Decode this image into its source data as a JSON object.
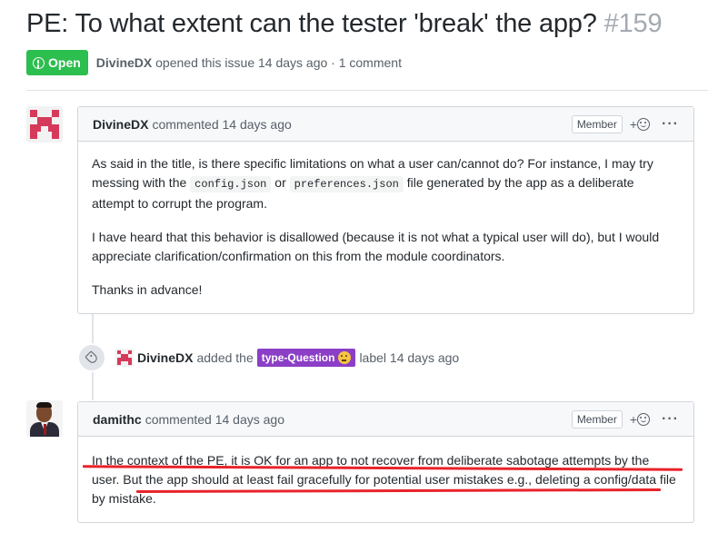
{
  "issue": {
    "title": "PE: To what extent can the tester 'break' the app?",
    "number": "#159",
    "state": "Open",
    "author": "DivineDX",
    "meta_rest": "opened this issue 14 days ago · 1 comment"
  },
  "comments": [
    {
      "author": "DivineDX",
      "action": "commented 14 days ago",
      "role": "Member",
      "react_plus": "+",
      "more": "···",
      "body": {
        "p1_a": "As said in the title, is there specific limitations on what a user can/cannot do? For instance, I may try messing with the ",
        "p1_code1": "config.json",
        "p1_b": " or ",
        "p1_code2": "preferences.json",
        "p1_c": " file generated by the app as a deliberate attempt to corrupt the program.",
        "p2": "I have heard that this behavior is disallowed (because it is not what a typical user will do), but I would appreciate clarification/confirmation on this from the module coordinators.",
        "p3": "Thanks in advance!"
      }
    },
    {
      "author": "damithc",
      "action": "commented 14 days ago",
      "role": "Member",
      "react_plus": "+",
      "more": "···",
      "body": {
        "line1": "In the context of the PE, it is OK for an app to not recover from deliberate sabotage attempts by the user.",
        "line2": "But the app should at least fail gracefully for potential user mistakes e.g., deleting a config/data file by mistake."
      }
    }
  ],
  "event": {
    "actor": "DivineDX",
    "text_before": "added the",
    "label": "type-Question",
    "label_emoji": "thinking-face",
    "text_after": "label 14 days ago"
  },
  "colors": {
    "open_green": "#2cbe4e",
    "label_purple": "#8b3fc7",
    "annotation_red": "#e8232a",
    "identicon": "#d53a5a"
  }
}
